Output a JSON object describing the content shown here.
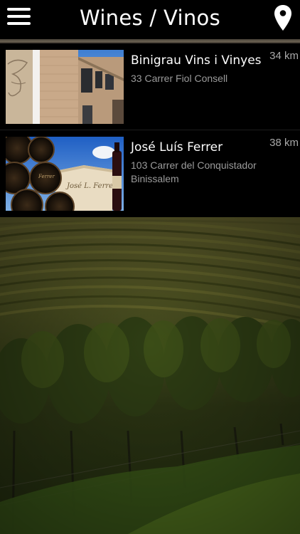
{
  "header": {
    "title": "Wines / Vinos",
    "menu_icon": "hamburger-menu-icon",
    "location_icon": "map-pin-icon"
  },
  "wineries": [
    {
      "name": "Binigrau Vins i Vinyes",
      "address": "33 Carrer Fiol Consell",
      "distance": "34 km"
    },
    {
      "name": "José Luís Ferrer",
      "address": "103 Carrer del Conquistador Binissalem",
      "distance": "38 km"
    }
  ],
  "colors": {
    "header_bg": "#000000",
    "list_bg": "#000000",
    "name_text": "#ffffff",
    "secondary_text": "#9b9b9b",
    "header_rule": "#6b6253",
    "vineyard_green": "#3c4a1c"
  }
}
